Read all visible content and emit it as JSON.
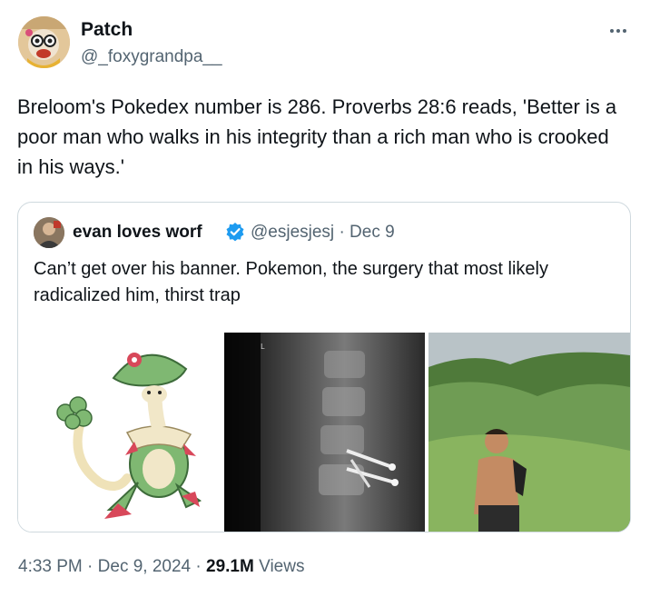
{
  "author": {
    "name": "Patch",
    "handle": "@_foxygrandpa__"
  },
  "tweet_text": "Breloom's Pokedex number is 286. Proverbs 28:6 reads, 'Better is a poor man who walks in his integrity than a rich man who is crooked in his ways.'",
  "quoted": {
    "name": "evan loves worf",
    "handle": "@esjesjesj",
    "date_sep": "·",
    "date": "Dec 9",
    "text": "Can’t get over his banner. Pokemon, the surgery that most likely radicalized him, thirst trap"
  },
  "meta": {
    "time": "4:33 PM",
    "sep1": "·",
    "date": "Dec 9, 2024",
    "sep2": "·",
    "views_count": "29.1M",
    "views_label": "Views"
  },
  "colors": {
    "text": "#0f1419",
    "secondary": "#536471",
    "border": "#cfd9de",
    "verified": "#1d9bf0"
  },
  "icons": [
    "more-icon",
    "verified-badge-icon"
  ]
}
